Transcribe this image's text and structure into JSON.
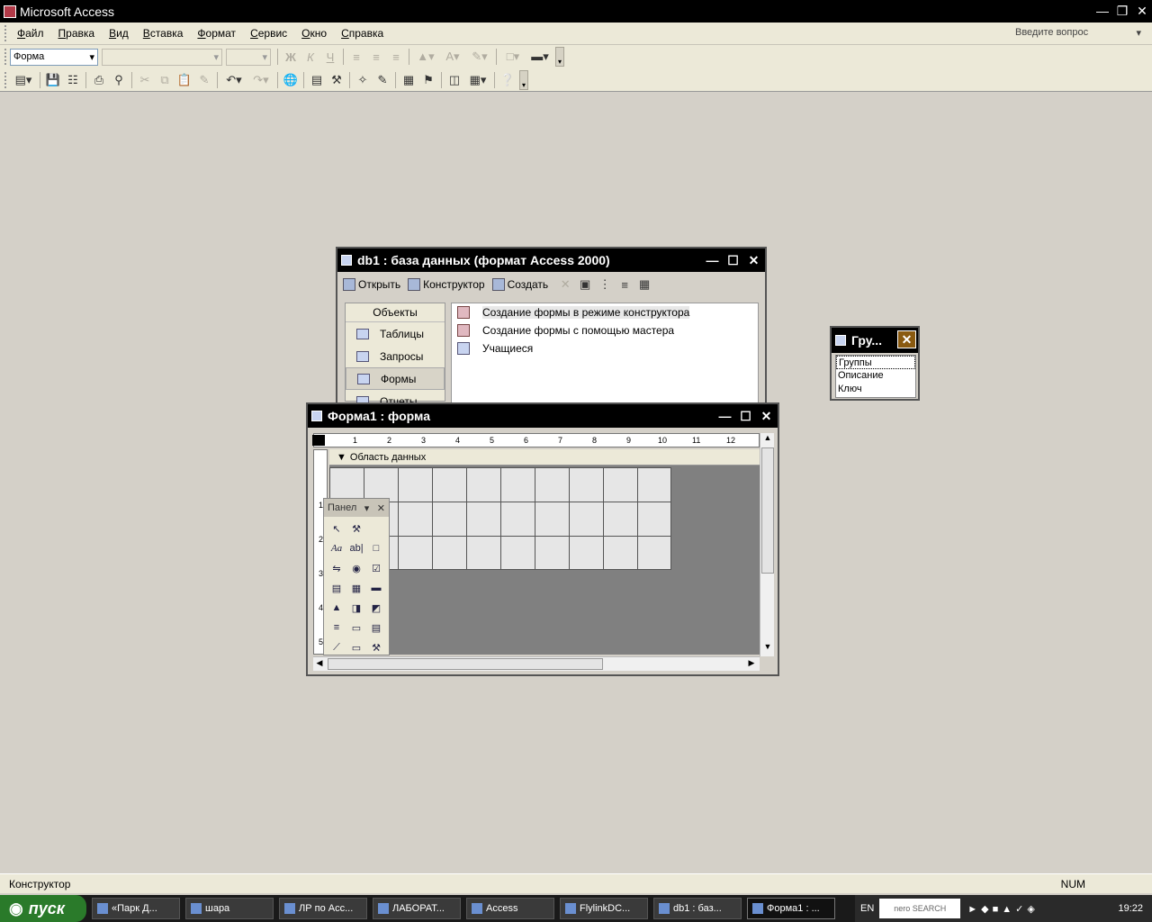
{
  "app": {
    "title": "Microsoft Access",
    "help_placeholder": "Введите вопрос"
  },
  "menu": [
    "Файл",
    "Правка",
    "Вид",
    "Вставка",
    "Формат",
    "Сервис",
    "Окно",
    "Справка"
  ],
  "format_toolbar": {
    "object_combo": "Форма"
  },
  "db_window": {
    "title": "db1 : база данных (формат Access 2000)",
    "toolbar": {
      "open": "Открыть",
      "design": "Конструктор",
      "create": "Создать"
    },
    "objects_header": "Объекты",
    "objects": [
      "Таблицы",
      "Запросы",
      "Формы",
      "Отчеты"
    ],
    "items": [
      "Создание формы в режиме конструктора",
      "Создание формы с помощью мастера",
      "Учащиеся"
    ]
  },
  "form_window": {
    "title": "Форма1 : форма",
    "section": "Область данных",
    "ruler_marks": [
      "1",
      "2",
      "3",
      "4",
      "5",
      "6",
      "7",
      "8",
      "9",
      "10",
      "11",
      "12"
    ],
    "vruler_marks": [
      "1",
      "2",
      "3",
      "4",
      "5"
    ]
  },
  "toolbox": {
    "title": "Панел"
  },
  "field_list": {
    "title": "Гру...",
    "fields": [
      "Группы",
      "Описание",
      "Ключ"
    ]
  },
  "status": {
    "left": "Конструктор",
    "right": "NUM"
  },
  "taskbar": {
    "start": "пуск",
    "tasks": [
      "«Парк Д...",
      "шара",
      "ЛР по Acc...",
      "ЛАБОРАТ...",
      "Access",
      "FlylinkDC...",
      "db1 : баз...",
      "Форма1 : ..."
    ],
    "lang": "EN",
    "nero": "nero SEARCH",
    "clock": "19:22"
  }
}
